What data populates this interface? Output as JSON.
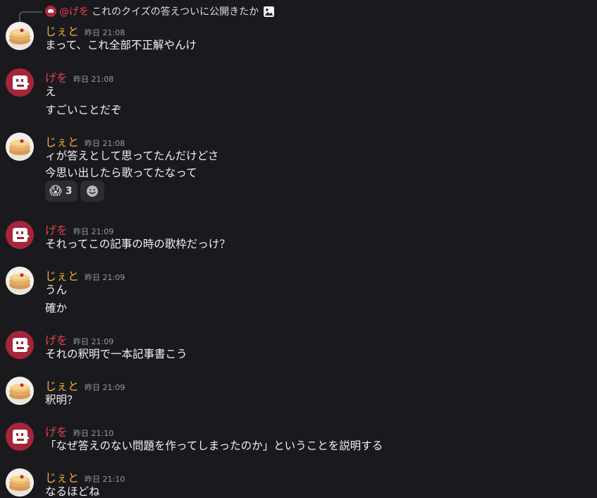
{
  "reply": {
    "name": "@げを",
    "text": "これのクイズの答えついに公開きたか"
  },
  "users": {
    "jet": "じぇと",
    "gewo": "げを"
  },
  "messages": [
    {
      "user": "じぇと",
      "time": "昨日 21:08",
      "lines": [
        "まって、これ全部不正解やんけ"
      ]
    },
    {
      "user": "げを",
      "time": "昨日 21:08",
      "lines": [
        "え",
        "すごいことだぞ"
      ]
    },
    {
      "user": "じぇと",
      "time": "昨日 21:08",
      "lines": [
        "ィが答えとして思ってたんだけどさ",
        "今思い出したら歌ってたなって"
      ],
      "reaction": {
        "emoji": "😱",
        "count": "3"
      }
    },
    {
      "user": "げを",
      "time": "昨日 21:09",
      "lines": [
        "それってこの記事の時の歌枠だっけ？"
      ]
    },
    {
      "user": "じぇと",
      "time": "昨日 21:09",
      "lines": [
        "うん",
        "確か"
      ]
    },
    {
      "user": "げを",
      "time": "昨日 21:09",
      "lines": [
        "それの釈明で一本記事書こう"
      ]
    },
    {
      "user": "じぇと",
      "time": "昨日 21:09",
      "lines": [
        "釈明？"
      ]
    },
    {
      "user": "げを",
      "time": "昨日 21:10",
      "lines": [
        "「なぜ答えのない問題を作ってしまったのか」ということを説明する"
      ]
    },
    {
      "user": "じぇと",
      "time": "昨日 21:10",
      "lines": [
        "なるほどね"
      ]
    }
  ],
  "colors": {
    "background": "#1a1a1e",
    "jet_name": "#f0b232",
    "gewo_name": "#e0424f",
    "timestamp": "#949ba4"
  },
  "icons": {
    "reply_spine": "reply-spine",
    "image": "image-icon",
    "add_reaction": "smile-icon"
  }
}
